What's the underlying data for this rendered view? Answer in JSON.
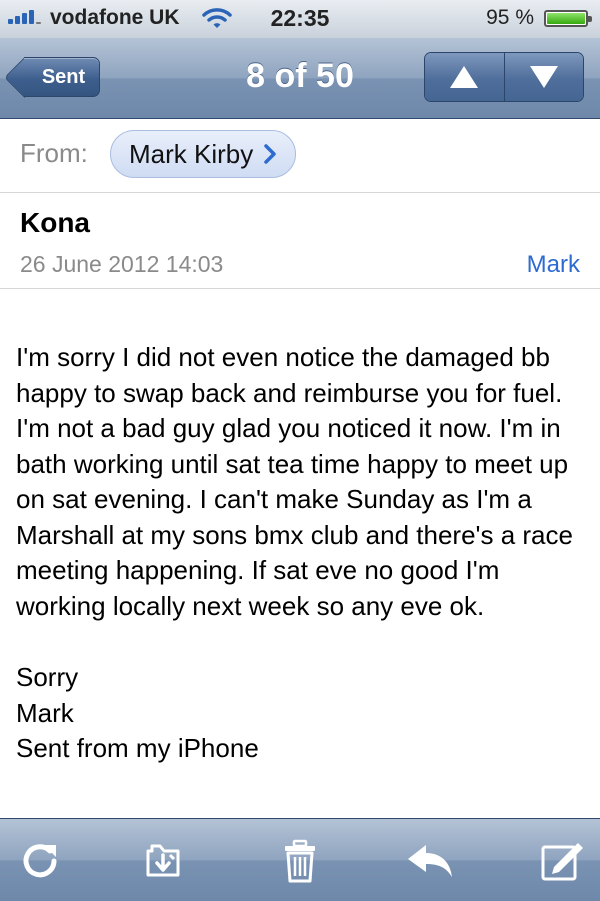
{
  "status_bar": {
    "carrier": "vodafone UK",
    "time": "22:35",
    "battery": "95 %"
  },
  "nav": {
    "back_label": "Sent",
    "title": "8 of 50",
    "prev_icon": "up-arrow-icon",
    "next_icon": "down-arrow-icon"
  },
  "from": {
    "label": "From:",
    "sender": "Mark Kirby"
  },
  "message": {
    "subject": "Kona",
    "date": "26 June 2012 14:03",
    "mark_link": "Mark",
    "body": "I'm sorry I did not even notice the damaged bb happy to swap back and reimburse you for fuel. I'm not a bad guy glad you noticed it now. I'm in bath working until sat tea time happy to meet up on sat evening. I can't make Sunday as I'm a Marshall at my sons bmx club and there's a race meeting happening. If sat eve no good I'm working locally next week so any eve ok.",
    "signoff": [
      "Sorry",
      "Mark",
      "Sent from my iPhone"
    ]
  },
  "toolbar": {
    "icons": [
      "refresh-icon",
      "move-folder-icon",
      "trash-icon",
      "reply-icon",
      "compose-icon"
    ]
  },
  "colors": {
    "link_blue": "#2d6bd0",
    "nav_blue": "#6e88aa"
  }
}
